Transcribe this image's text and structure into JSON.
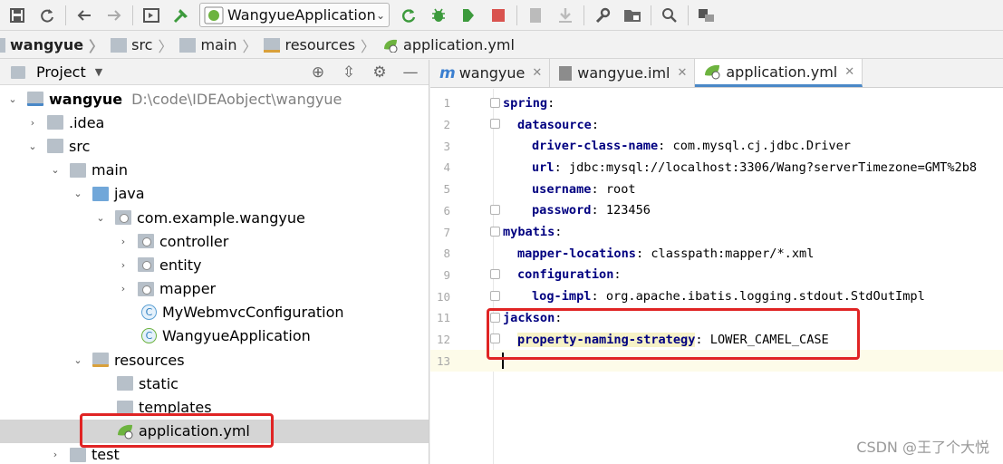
{
  "toolbar": {
    "run_config_label": "WangyueApplication",
    "icons": [
      "save-icon",
      "sync-icon",
      "back-icon",
      "forward-icon",
      "run-window-icon",
      "build-icon",
      "rerun-icon",
      "debug-icon",
      "coverage-icon",
      "stop-icon",
      "vcs-icon",
      "vcs-down-icon",
      "settings-wrench-icon",
      "project-structure-icon",
      "search-icon",
      "tool-window-icon"
    ]
  },
  "breadcrumb": [
    "wangyue",
    "src",
    "main",
    "resources",
    "application.yml"
  ],
  "project_panel": {
    "title": "Project",
    "root_label": "wangyue",
    "root_path": "D:\\code\\IDEAobject\\wangyue",
    "tree": [
      {
        "label": ".idea"
      },
      {
        "label": "src"
      },
      {
        "label": "main"
      },
      {
        "label": "java"
      },
      {
        "label": "com.example.wangyue"
      },
      {
        "label": "controller"
      },
      {
        "label": "entity"
      },
      {
        "label": "mapper"
      },
      {
        "label": "MyWebmvcConfiguration"
      },
      {
        "label": "WangyueApplication"
      },
      {
        "label": "resources"
      },
      {
        "label": "static"
      },
      {
        "label": "templates"
      },
      {
        "label": "application.yml"
      },
      {
        "label": "test"
      }
    ]
  },
  "editor": {
    "tabs": [
      {
        "label": "wangyue"
      },
      {
        "label": "wangyue.iml"
      },
      {
        "label": "application.yml"
      }
    ],
    "lines": [
      {
        "n": "1",
        "key": "spring",
        "sep": ":",
        "value": ""
      },
      {
        "n": "2",
        "key": "datasource",
        "sep": ":",
        "value": ""
      },
      {
        "n": "3",
        "key": "driver-class-name",
        "sep": ": ",
        "value": "com.mysql.cj.jdbc.Driver"
      },
      {
        "n": "4",
        "key": "url",
        "sep": ": ",
        "value": "jdbc:mysql://localhost:3306/Wang?serverTimezone=GMT%2b8"
      },
      {
        "n": "5",
        "key": "username",
        "sep": ": ",
        "value": "root"
      },
      {
        "n": "6",
        "key": "password",
        "sep": ": ",
        "value": "123456"
      },
      {
        "n": "7",
        "key": "mybatis",
        "sep": ":",
        "value": ""
      },
      {
        "n": "8",
        "key": "mapper-locations",
        "sep": ": ",
        "value": "classpath:mapper/*.xml"
      },
      {
        "n": "9",
        "key": "configuration",
        "sep": ":",
        "value": ""
      },
      {
        "n": "10",
        "key": "log-impl",
        "sep": ": ",
        "value": "org.apache.ibatis.logging.stdout.StdOutImpl"
      },
      {
        "n": "11",
        "key": "jackson",
        "sep": ":",
        "value": ""
      },
      {
        "n": "12",
        "key": "property-naming-strategy",
        "sep": ": ",
        "value": "LOWER_CAMEL_CASE"
      },
      {
        "n": "13",
        "key": "",
        "sep": "",
        "value": ""
      }
    ]
  },
  "watermark": "CSDN @王了个大悦",
  "colors": {
    "yaml_key": "#000080",
    "highlight_box": "#e02424",
    "selection": "#d5d5d5",
    "tab_underline": "#4a88c7"
  }
}
